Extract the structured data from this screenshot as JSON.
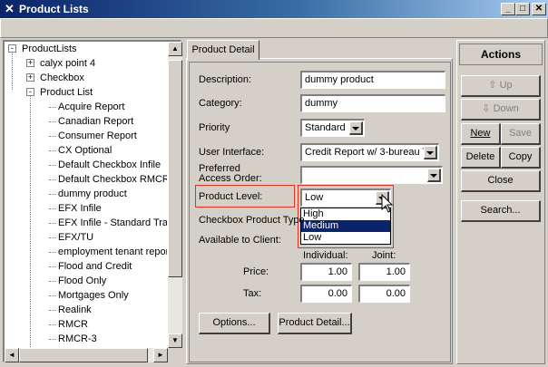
{
  "window": {
    "title": "Product Lists",
    "icon": "app-icon"
  },
  "tree": {
    "root": "ProductLists",
    "items": [
      {
        "label": "calyx point 4",
        "level": 1,
        "expander": "+"
      },
      {
        "label": "Checkbox",
        "level": 1,
        "expander": "+"
      },
      {
        "label": "Product List",
        "level": 1,
        "expander": "-"
      },
      {
        "label": "Acquire Report",
        "level": 2
      },
      {
        "label": "Canadian Report",
        "level": 2
      },
      {
        "label": "Consumer Report",
        "level": 2
      },
      {
        "label": "CX Optional",
        "level": 2
      },
      {
        "label": "Default Checkbox Infile",
        "level": 2
      },
      {
        "label": "Default Checkbox RMCR",
        "level": 2
      },
      {
        "label": "dummy product",
        "level": 2
      },
      {
        "label": "EFX Infile",
        "level": 2
      },
      {
        "label": "EFX Infile - Standard Trac",
        "level": 2
      },
      {
        "label": "EFX/TU",
        "level": 2
      },
      {
        "label": "employment tenant report",
        "level": 2
      },
      {
        "label": "Flood and Credit",
        "level": 2
      },
      {
        "label": "Flood Only",
        "level": 2
      },
      {
        "label": "Mortgages Only",
        "level": 2
      },
      {
        "label": "Realink",
        "level": 2
      },
      {
        "label": "RMCR",
        "level": 2
      },
      {
        "label": "RMCR-3",
        "level": 2
      }
    ]
  },
  "detail": {
    "tab": "Product Detail",
    "description_label": "Description:",
    "description_value": "dummy product",
    "category_label": "Category:",
    "category_value": "dummy",
    "priority_label": "Priority",
    "priority_value": "Standard",
    "ui_label": "User Interface:",
    "ui_value": "Credit Report w/ 3-bureau T",
    "preferred_label_1": "Preferred",
    "preferred_label_2": "Access Order:",
    "preferred_value": "",
    "level_label": "Product Level:",
    "level_value": "Low",
    "level_options": [
      "High",
      "Medium",
      "Low"
    ],
    "level_highlighted": "Medium",
    "checkbox_type_label": "Checkbox Product Type",
    "available_label": "Available to Client:",
    "individual_label": "Individual:",
    "joint_label": "Joint:",
    "price_label": "Price:",
    "price_individual": "1.00",
    "price_joint": "1.00",
    "tax_label": "Tax:",
    "tax_individual": "0.00",
    "tax_joint": "0.00",
    "options_button": "Options...",
    "product_detail_button": "Product Detail..."
  },
  "actions": {
    "header": "Actions",
    "up": "Up",
    "down": "Down",
    "new": "New",
    "save": "Save",
    "delete": "Delete",
    "copy": "Copy",
    "close": "Close",
    "search": "Search..."
  },
  "colors": {
    "title_start": "#0a246a",
    "selection": "#0a246a",
    "highlight_border": "#e03020"
  }
}
